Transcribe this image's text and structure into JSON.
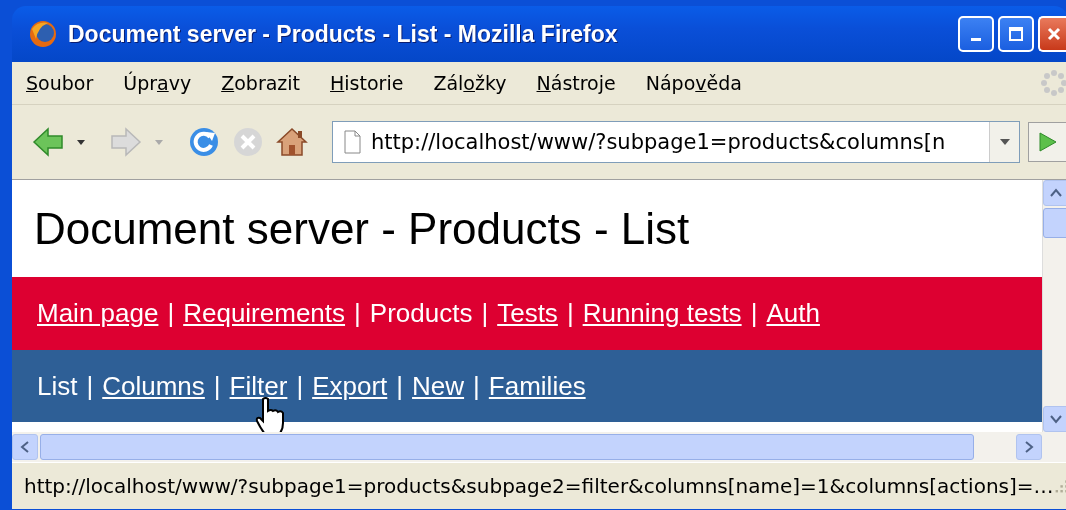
{
  "window": {
    "title": "Document server - Products - List - Mozilla Firefox"
  },
  "menu_bar": [
    {
      "key": "S",
      "after": "oubor"
    },
    {
      "before": "Úpr",
      "key": "a",
      "after": "vy"
    },
    {
      "key": "Z",
      "after": "obrazit"
    },
    {
      "key": "H",
      "after": "istorie"
    },
    {
      "before": "Zál",
      "key": "o",
      "after": "žky"
    },
    {
      "key": "N",
      "after": "ástroje"
    },
    {
      "before": "Nápo",
      "key": "v",
      "after": "ěda"
    }
  ],
  "toolbar": {
    "buttons": [
      {
        "kind": "back",
        "disabled": false
      },
      {
        "kind": "forward",
        "disabled": true
      },
      {
        "kind": "reload",
        "disabled": false
      },
      {
        "kind": "stop",
        "disabled": true
      },
      {
        "kind": "home",
        "disabled": false
      }
    ],
    "address": {
      "value": "http://localhost/www/?subpage1=products&columns[n"
    }
  },
  "page": {
    "heading": "Document server - Products - List",
    "main_nav": [
      {
        "kind": "link",
        "label": "Main page"
      },
      {
        "kind": "separator",
        "label": "|"
      },
      {
        "kind": "link",
        "label": "Requirements"
      },
      {
        "kind": "separator",
        "label": "|"
      },
      {
        "kind": "current",
        "label": "Products"
      },
      {
        "kind": "separator",
        "label": "|"
      },
      {
        "kind": "link",
        "label": "Tests"
      },
      {
        "kind": "separator",
        "label": "|"
      },
      {
        "kind": "link",
        "label": "Running tests"
      },
      {
        "kind": "separator",
        "label": "|"
      },
      {
        "kind": "link",
        "label": "Auth"
      }
    ],
    "sub_nav": [
      {
        "kind": "current",
        "label": "List",
        "hovered": false
      },
      {
        "kind": "separator",
        "label": "|",
        "hovered": false
      },
      {
        "kind": "link",
        "label": "Columns",
        "hovered": false
      },
      {
        "kind": "separator",
        "label": "|",
        "hovered": false
      },
      {
        "kind": "link",
        "label": "Filter",
        "hovered": true
      },
      {
        "kind": "separator",
        "label": "|",
        "hovered": false
      },
      {
        "kind": "link",
        "label": "Export",
        "hovered": false
      },
      {
        "kind": "separator",
        "label": "|",
        "hovered": false
      },
      {
        "kind": "link",
        "label": "New",
        "hovered": false
      },
      {
        "kind": "separator",
        "label": "|",
        "hovered": false
      },
      {
        "kind": "link",
        "label": "Families",
        "hovered": false
      }
    ]
  },
  "status_bar": {
    "text": "http://localhost/www/?subpage1=products&subpage2=filter&columns[name]=1&columns[actions]=…"
  }
}
